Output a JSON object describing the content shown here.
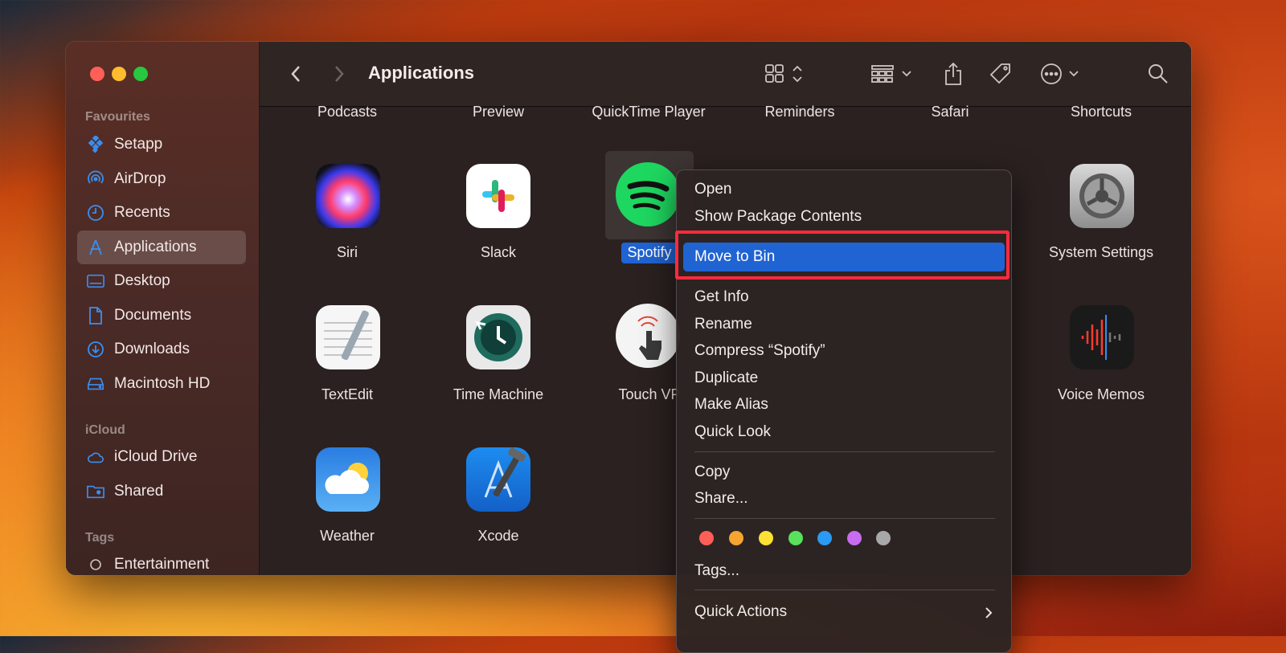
{
  "sidebar": {
    "favourites_heading": "Favourites",
    "favourites": [
      {
        "label": "Setapp",
        "icon": "setapp-icon"
      },
      {
        "label": "AirDrop",
        "icon": "airdrop-icon"
      },
      {
        "label": "Recents",
        "icon": "clock-icon"
      },
      {
        "label": "Applications",
        "icon": "applications-icon"
      },
      {
        "label": "Desktop",
        "icon": "desktop-icon"
      },
      {
        "label": "Documents",
        "icon": "document-icon"
      },
      {
        "label": "Downloads",
        "icon": "download-icon"
      },
      {
        "label": "Macintosh HD",
        "icon": "drive-icon"
      }
    ],
    "icloud_heading": "iCloud",
    "icloud": [
      {
        "label": "iCloud Drive",
        "icon": "cloud-icon"
      },
      {
        "label": "Shared",
        "icon": "shared-folder-icon"
      }
    ],
    "tags_heading": "Tags",
    "tags": [
      {
        "label": "Entertainment",
        "icon": "tag-circle-icon"
      }
    ]
  },
  "toolbar": {
    "title": "Applications"
  },
  "top_row_labels": [
    "Podcasts",
    "Preview",
    "QuickTime Player",
    "Reminders",
    "Safari",
    "Shortcuts"
  ],
  "apps": {
    "siri": "Siri",
    "slack": "Slack",
    "spotify": "Spotify",
    "system_settings": "System Settings",
    "textedit": "TextEdit",
    "time_machine": "Time Machine",
    "touch_vpn": "Touch VP",
    "voice_memos": "Voice Memos",
    "weather": "Weather",
    "xcode": "Xcode"
  },
  "context_menu": {
    "open": "Open",
    "show_package": "Show Package Contents",
    "move_to_bin": "Move to Bin",
    "get_info": "Get Info",
    "rename": "Rename",
    "compress": "Compress “Spotify”",
    "duplicate": "Duplicate",
    "make_alias": "Make Alias",
    "quick_look": "Quick Look",
    "copy": "Copy",
    "share": "Share...",
    "tags": "Tags...",
    "quick_actions": "Quick Actions",
    "tag_colors": [
      "#ff5f57",
      "#f7a531",
      "#fde133",
      "#5ae05d",
      "#2b9af3",
      "#c86cf0",
      "#a8a8a8"
    ]
  }
}
